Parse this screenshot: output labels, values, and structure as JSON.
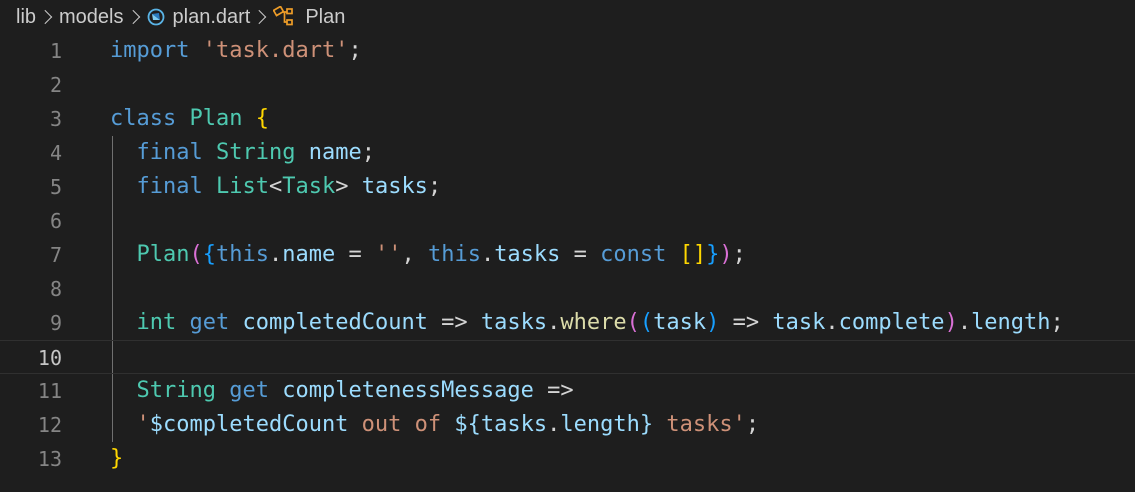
{
  "breadcrumb": {
    "items": [
      "lib",
      "models",
      "plan.dart",
      "Plan"
    ],
    "icons": [
      "dart-file-icon",
      "class-symbol-icon"
    ]
  },
  "editor": {
    "language": "dart",
    "current_line": 10,
    "lines": [
      {
        "n": "1",
        "tokens": [
          [
            "import",
            "kw"
          ],
          [
            " ",
            "pun"
          ],
          [
            "'task.dart'",
            "str"
          ],
          [
            ";",
            "pun"
          ]
        ]
      },
      {
        "n": "2",
        "tokens": []
      },
      {
        "n": "3",
        "tokens": [
          [
            "class",
            "kw"
          ],
          [
            " ",
            "pun"
          ],
          [
            "Plan",
            "ty"
          ],
          [
            " ",
            "pun"
          ],
          [
            "{",
            "b1"
          ]
        ]
      },
      {
        "n": "4",
        "tokens": [
          [
            "  ",
            "pun"
          ],
          [
            "final",
            "kw"
          ],
          [
            " ",
            "pun"
          ],
          [
            "String",
            "ty"
          ],
          [
            " ",
            "pun"
          ],
          [
            "name",
            "var"
          ],
          [
            ";",
            "pun"
          ]
        ]
      },
      {
        "n": "5",
        "tokens": [
          [
            "  ",
            "pun"
          ],
          [
            "final",
            "kw"
          ],
          [
            " ",
            "pun"
          ],
          [
            "List",
            "ty"
          ],
          [
            "<",
            "pun"
          ],
          [
            "Task",
            "ty"
          ],
          [
            ">",
            "pun"
          ],
          [
            " ",
            "pun"
          ],
          [
            "tasks",
            "var"
          ],
          [
            ";",
            "pun"
          ]
        ]
      },
      {
        "n": "6",
        "tokens": []
      },
      {
        "n": "7",
        "tokens": [
          [
            "  ",
            "pun"
          ],
          [
            "Plan",
            "ty"
          ],
          [
            "(",
            "b2"
          ],
          [
            "{",
            "b3"
          ],
          [
            "this",
            "kw"
          ],
          [
            ".",
            "pun"
          ],
          [
            "name",
            "var"
          ],
          [
            " = ",
            "pun"
          ],
          [
            "''",
            "str"
          ],
          [
            ", ",
            "pun"
          ],
          [
            "this",
            "kw"
          ],
          [
            ".",
            "pun"
          ],
          [
            "tasks",
            "var"
          ],
          [
            " = ",
            "pun"
          ],
          [
            "const",
            "kw"
          ],
          [
            " ",
            "pun"
          ],
          [
            "[]",
            "b1"
          ],
          [
            "}",
            "b3"
          ],
          [
            ")",
            "b2"
          ],
          [
            ";",
            "pun"
          ]
        ]
      },
      {
        "n": "8",
        "tokens": []
      },
      {
        "n": "9",
        "tokens": [
          [
            "  ",
            "pun"
          ],
          [
            "int",
            "ty"
          ],
          [
            " ",
            "pun"
          ],
          [
            "get",
            "kw"
          ],
          [
            " ",
            "pun"
          ],
          [
            "completedCount",
            "var"
          ],
          [
            " => ",
            "pun"
          ],
          [
            "tasks",
            "var"
          ],
          [
            ".",
            "pun"
          ],
          [
            "where",
            "fn"
          ],
          [
            "(",
            "b2"
          ],
          [
            "(",
            "b3"
          ],
          [
            "task",
            "var"
          ],
          [
            ")",
            "b3"
          ],
          [
            " => ",
            "pun"
          ],
          [
            "task",
            "var"
          ],
          [
            ".",
            "pun"
          ],
          [
            "complete",
            "var"
          ],
          [
            ")",
            "b2"
          ],
          [
            ".",
            "pun"
          ],
          [
            "length",
            "var"
          ],
          [
            ";",
            "pun"
          ]
        ]
      },
      {
        "n": "10",
        "tokens": []
      },
      {
        "n": "11",
        "tokens": [
          [
            "  ",
            "pun"
          ],
          [
            "String",
            "ty"
          ],
          [
            " ",
            "pun"
          ],
          [
            "get",
            "kw"
          ],
          [
            " ",
            "pun"
          ],
          [
            "completenessMessage",
            "var"
          ],
          [
            " =>",
            "pun"
          ]
        ]
      },
      {
        "n": "12",
        "tokens": [
          [
            "  ",
            "pun"
          ],
          [
            "'",
            "str"
          ],
          [
            "$",
            "var"
          ],
          [
            "completedCount",
            "var"
          ],
          [
            " out of ",
            "str"
          ],
          [
            "${",
            "var"
          ],
          [
            "tasks",
            "var"
          ],
          [
            ".",
            "pun"
          ],
          [
            "length",
            "var"
          ],
          [
            "}",
            "var"
          ],
          [
            " tasks'",
            "str"
          ],
          [
            ";",
            "pun"
          ]
        ]
      },
      {
        "n": "13",
        "tokens": [
          [
            "}",
            "b1"
          ]
        ]
      }
    ]
  }
}
